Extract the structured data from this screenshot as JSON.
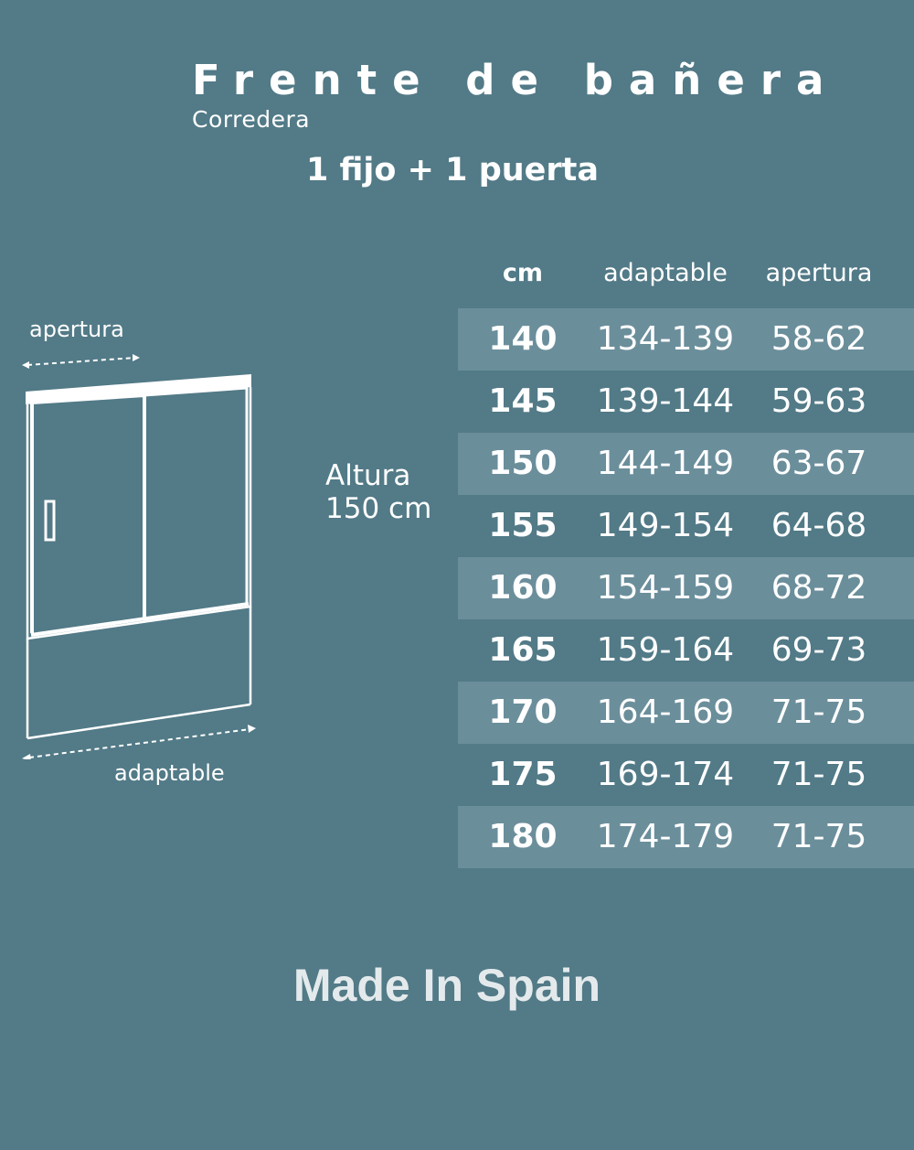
{
  "header": {
    "title": "Frente de bañera",
    "subtitle": "Corredera",
    "configuration": "1 fijo + 1 puerta"
  },
  "diagram": {
    "opening_label": "apertura",
    "adaptable_label": "adaptable",
    "icons": [
      "sliding-shower-screen-icon",
      "dashed-arrow-icon",
      "handle-icon"
    ]
  },
  "height": {
    "line1": "Altura",
    "line2": "150 cm"
  },
  "table": {
    "headers": [
      "cm",
      "adaptable",
      "apertura"
    ],
    "rows": [
      {
        "cm": "140",
        "adaptable": "134-139",
        "apertura": "58-62"
      },
      {
        "cm": "145",
        "adaptable": "139-144",
        "apertura": "59-63"
      },
      {
        "cm": "150",
        "adaptable": "144-149",
        "apertura": "63-67"
      },
      {
        "cm": "155",
        "adaptable": "149-154",
        "apertura": "64-68"
      },
      {
        "cm": "160",
        "adaptable": "154-159",
        "apertura": "68-72"
      },
      {
        "cm": "165",
        "adaptable": "159-164",
        "apertura": "69-73"
      },
      {
        "cm": "170",
        "adaptable": "164-169",
        "apertura": "71-75"
      },
      {
        "cm": "175",
        "adaptable": "169-174",
        "apertura": "71-75"
      },
      {
        "cm": "180",
        "adaptable": "174-179",
        "apertura": "71-75"
      }
    ]
  },
  "footer": {
    "text": "Made In Spain"
  },
  "colors": {
    "background": "#527a87",
    "row_shade": "#6b8e9b",
    "text": "#ffffff",
    "footer_text": "#e4eaec"
  }
}
